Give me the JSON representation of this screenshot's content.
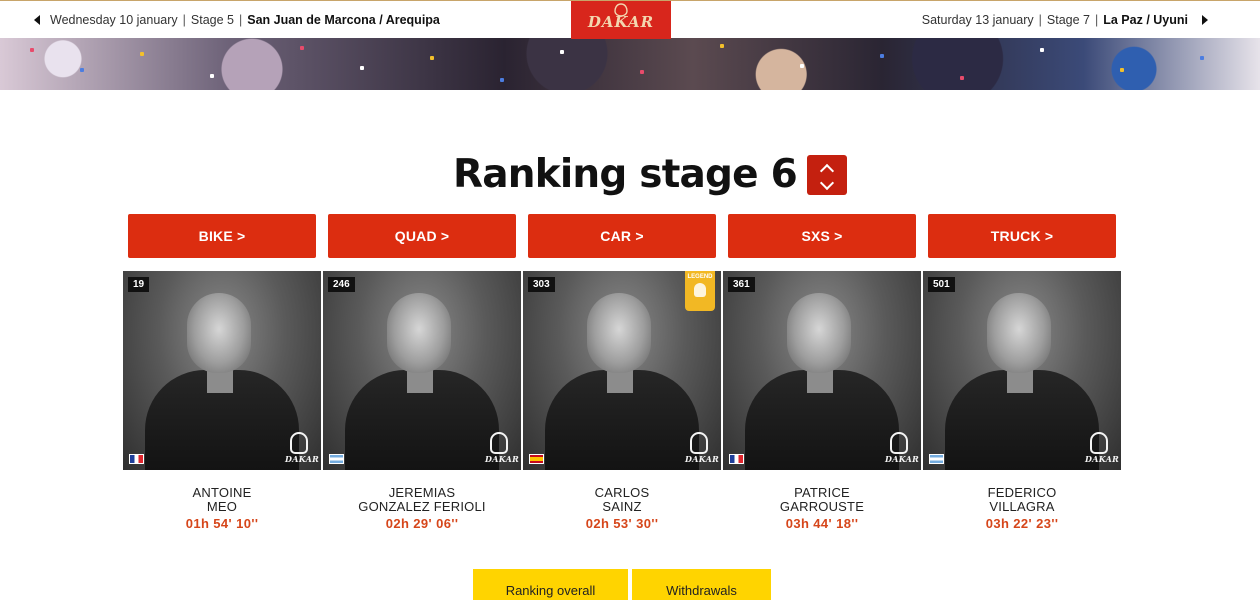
{
  "topnav": {
    "prev": {
      "date": "Wednesday 10 january",
      "stage": "Stage 5",
      "route": "San Juan de Marcona / Arequipa"
    },
    "next": {
      "date": "Saturday 13 january",
      "stage": "Stage 7",
      "route": "La Paz / Uyuni"
    },
    "separator": "|",
    "logo_text": "DAKAR"
  },
  "title": "Ranking stage 6",
  "categories": [
    {
      "label": "BIKE >"
    },
    {
      "label": "QUAD >"
    },
    {
      "label": "CAR >"
    },
    {
      "label": "SXS >"
    },
    {
      "label": "TRUCK >"
    }
  ],
  "competitors": [
    {
      "number": "19",
      "first": "ANTOINE",
      "last": "MEO",
      "time": "01h 54' 10''",
      "flag": "fr",
      "legend": false
    },
    {
      "number": "246",
      "first": "JEREMIAS",
      "last": "GONZALEZ FERIOLI",
      "time": "02h 29' 06''",
      "flag": "ar",
      "legend": false
    },
    {
      "number": "303",
      "first": "CARLOS",
      "last": "SAINZ",
      "time": "02h 53' 30''",
      "flag": "es",
      "legend": true,
      "legend_label": "LEGEND"
    },
    {
      "number": "361",
      "first": "PATRICE",
      "last": "GARROUSTE",
      "time": "03h 44' 18''",
      "flag": "fr",
      "legend": false
    },
    {
      "number": "501",
      "first": "FEDERICO",
      "last": "VILLAGRA",
      "time": "03h 22' 23''",
      "flag": "ar",
      "legend": false
    }
  ],
  "photo_watermark": "DAKAR",
  "bottom_buttons": {
    "ranking_overall": "Ranking overall",
    "withdrawals": "Withdrawals"
  },
  "colors": {
    "accent_red": "#dc2d10",
    "toggle_red": "#c4200f",
    "time_orange": "#d6461a",
    "yellow": "#ffd400",
    "legend_gold": "#f2b824"
  }
}
